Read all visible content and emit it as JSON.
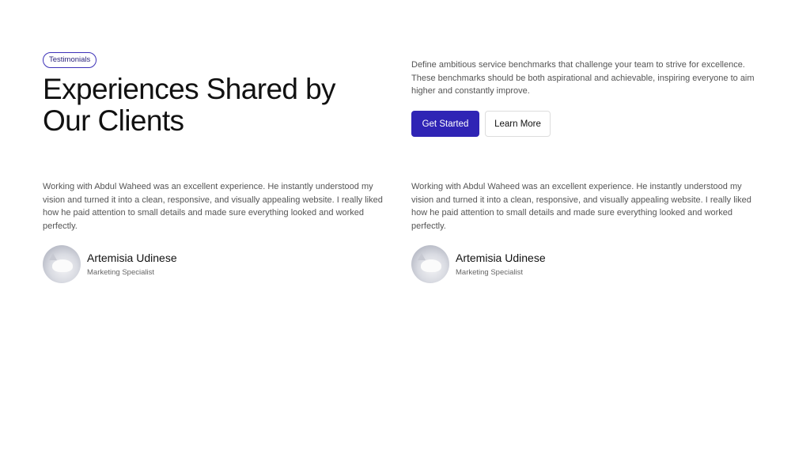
{
  "header": {
    "badge": "Testimonials",
    "title": "Experiences Shared by Our Clients",
    "intro": "Define ambitious service benchmarks that challenge your team to strive for excellence. These benchmarks should be both aspirational and achievable, inspiring everyone to aim higher and constantly improve.",
    "primary_button": "Get Started",
    "secondary_button": "Learn More"
  },
  "testimonials": [
    {
      "quote": "Working with Abdul Waheed was an excellent experience. He instantly understood my vision and turned it into a clean, responsive, and visually appealing website. I really liked how he paid attention to small details and made sure everything looked and worked perfectly.",
      "name": "Artemisia Udinese",
      "role": "Marketing Specialist"
    },
    {
      "quote": "Working with Abdul Waheed was an excellent experience. He instantly understood my vision and turned it into a clean, responsive, and visually appealing website. I really liked how he paid attention to small details and made sure everything looked and worked perfectly.",
      "name": "Artemisia Udinese",
      "role": "Marketing Specialist"
    }
  ],
  "colors": {
    "accent": "#2f24b5",
    "text": "#111111",
    "muted": "#555555"
  }
}
